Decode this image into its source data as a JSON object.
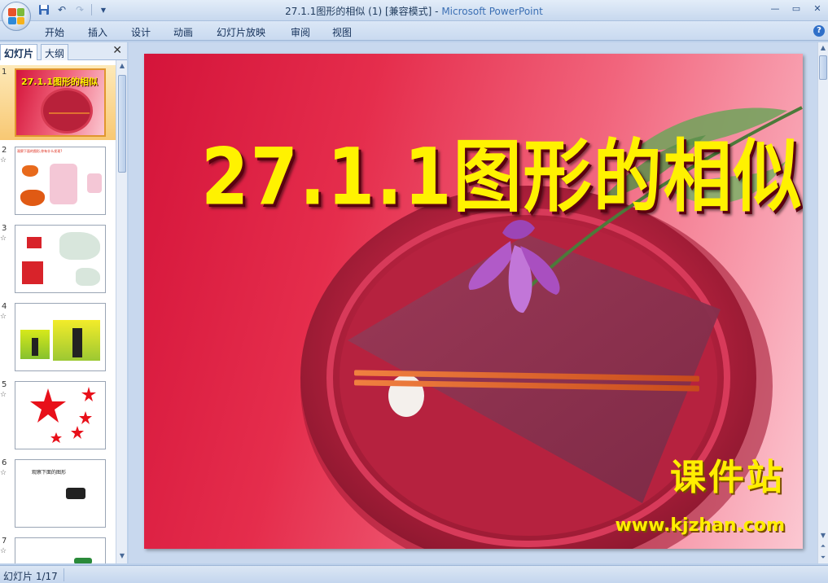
{
  "window": {
    "title": "27.1.1图形的相似 (1) [兼容模式]",
    "title_separator": " - ",
    "app_name": "Microsoft PowerPoint",
    "minimize_icon": "minimize-icon",
    "maximize_icon": "maximize-icon",
    "close_icon": "close-icon"
  },
  "quick_access": [
    "save-icon",
    "undo-icon",
    "redo-icon",
    "customize-icon"
  ],
  "ribbon": {
    "tabs": [
      {
        "label": "开始"
      },
      {
        "label": "插入"
      },
      {
        "label": "设计"
      },
      {
        "label": "动画"
      },
      {
        "label": "幻灯片放映"
      },
      {
        "label": "审阅"
      },
      {
        "label": "视图"
      }
    ],
    "help_label": "?"
  },
  "panel": {
    "tabs": [
      {
        "label": "幻灯片",
        "active": true
      },
      {
        "label": "大纲",
        "active": false
      }
    ],
    "close_label": "✕",
    "thumbnails": [
      {
        "num": "1",
        "title": "27.1.1图形的相似",
        "active": true
      },
      {
        "num": "2",
        "title": "观察下面的图形,你有什么发现?",
        "star": "☆"
      },
      {
        "num": "3",
        "star": "☆"
      },
      {
        "num": "4",
        "star": "☆"
      },
      {
        "num": "5",
        "star": "☆"
      },
      {
        "num": "6",
        "title": "观察下面的图形",
        "star": "☆"
      },
      {
        "num": "7",
        "star": "☆"
      }
    ]
  },
  "slide": {
    "title": "27.1.1图形的相似",
    "watermark": "课件站",
    "watermark_url": "www.kjzhan.com",
    "title_color": "#fff200"
  },
  "status": {
    "slide_counter": "幻灯片 1/17"
  }
}
